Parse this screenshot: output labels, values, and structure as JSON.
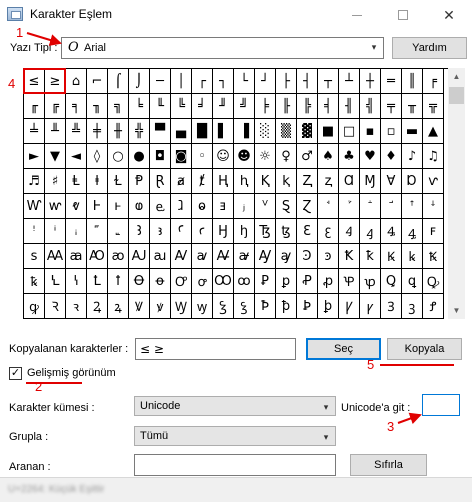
{
  "window": {
    "title": "Karakter Eşlem"
  },
  "font_row": {
    "label": "Yazı Tipi :",
    "glyph": "O",
    "font_name": "Arial",
    "help_button": "Yardım"
  },
  "grid": {
    "cells": [
      "≤",
      "≥",
      "⌂",
      "⌐",
      "⌠",
      "⌡",
      "─",
      "│",
      "┌",
      "┐",
      "└",
      "┘",
      "├",
      "┤",
      "┬",
      "┴",
      "┼",
      "═",
      "║",
      "╒",
      "╓",
      "╔",
      "╕",
      "╖",
      "╗",
      "╘",
      "╙",
      "╚",
      "╛",
      "╜",
      "╝",
      "╞",
      "╟",
      "╠",
      "╡",
      "╢",
      "╣",
      "╤",
      "╥",
      "╦",
      "╧",
      "╨",
      "╩",
      "╪",
      "╫",
      "╬",
      "▀",
      "▄",
      "█",
      "▌",
      "▐",
      "░",
      "▒",
      "▓",
      "■",
      "□",
      "▪",
      "▫",
      "▬",
      "▲",
      "►",
      "▼",
      "◄",
      "◊",
      "○",
      "●",
      "◘",
      "◙",
      "◦",
      "☺",
      "☻",
      "☼",
      "♀",
      "♂",
      "♠",
      "♣",
      "♥",
      "♦",
      "♪",
      "♫",
      "♬",
      "♯",
      "Ⱡ",
      "ⱡ",
      "Ɫ",
      "Ᵽ",
      "Ɽ",
      "ⱥ",
      "ⱦ",
      "Ⱨ",
      "ⱨ",
      "Ⱪ",
      "ⱪ",
      "Ⱬ",
      "ⱬ",
      "Ɑ",
      "Ɱ",
      "Ɐ",
      "Ɒ",
      "ⱱ",
      "Ⱳ",
      "ⱳ",
      "ⱴ",
      "Ⱶ",
      "ⱶ",
      "ⱷ",
      "ⱸ",
      "ⱹ",
      "ⱺ",
      "ⱻ",
      "ⱼ",
      "ⱽ",
      "Ȿ",
      "Ɀ",
      "ꜗ",
      "ꜘ",
      "ꜙ",
      "ꜚ",
      "ꜛ",
      "ꜜ",
      "ꜝ",
      "ꜞ",
      "ꜟ",
      "꜠",
      "꜡",
      "Ꜣ",
      "ꜣ",
      "Ꜥ",
      "ꜥ",
      "Ꜧ",
      "ꜧ",
      "Ꜩ",
      "ꜩ",
      "Ꜫ",
      "ꜫ",
      "Ꜭ",
      "ꜭ",
      "Ꜯ",
      "ꜯ",
      "ꜰ",
      "ꜱ",
      "Ꜳ",
      "ꜳ",
      "Ꜵ",
      "ꜵ",
      "Ꜷ",
      "ꜷ",
      "Ꜹ",
      "ꜹ",
      "Ꜻ",
      "ꜻ",
      "Ꜽ",
      "ꜽ",
      "Ꜿ",
      "ꜿ",
      "Ꝁ",
      "ꝁ",
      "Ꝃ",
      "ꝃ",
      "Ꝅ",
      "ꝅ",
      "Ꝇ",
      "ꝇ",
      "Ꝉ",
      "ꝉ",
      "Ꝋ",
      "ꝋ",
      "Ꝍ",
      "ꝍ",
      "Ꝏ",
      "ꝏ",
      "Ꝑ",
      "ꝑ",
      "Ꝓ",
      "ꝓ",
      "Ꝕ",
      "ꝕ",
      "Ꝗ",
      "ꝗ",
      "Ꝙ",
      "ꝙ",
      "Ꝛ",
      "ꝛ",
      "Ꝝ",
      "ꝝ",
      "Ꝟ",
      "ꝟ",
      "Ꝡ",
      "ꝡ",
      "Ꝣ",
      "ꝣ",
      "Ꝥ",
      "ꝥ",
      "Ꝧ",
      "ꝧ",
      "Ꝩ",
      "ꝩ",
      "Ꝫ",
      "ꝫ",
      "Ꝭ"
    ]
  },
  "copy_row": {
    "label": "Kopyalanan karakterler :",
    "value": "≤ ≥",
    "select_button": "Seç",
    "copy_button": "Kopyala"
  },
  "advanced": {
    "checkbox_label": "Gelişmiş görünüm",
    "checked": true,
    "check_mark": "✓"
  },
  "charset": {
    "label": "Karakter kümesi :",
    "value": "Unicode"
  },
  "group": {
    "label": "Grupla :",
    "value": "Tümü"
  },
  "unicode_goto": {
    "label": "Unicode'a git :",
    "value": ""
  },
  "search": {
    "label": "Aranan :",
    "value": "",
    "reset_button": "Sıfırla"
  },
  "status": {
    "text": "U+2264: Küçük Eşittir"
  },
  "annotations": {
    "n1": "1",
    "n2": "2",
    "n3": "3",
    "n4": "4",
    "n5": "5",
    "color": "#e00000"
  }
}
